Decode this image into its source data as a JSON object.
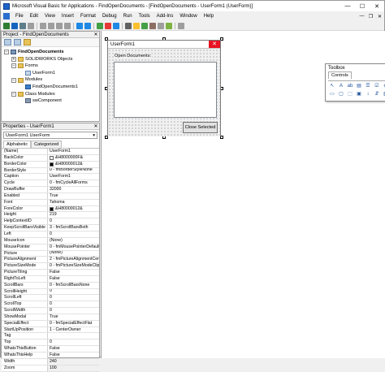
{
  "window": {
    "title": "Microsoft Visual Basic for Applications - FindOpenDocuments - [FindOpenDocuments - UserForm1 (UserForm)]",
    "minimize": "—",
    "maximize": "☐",
    "close": "✕"
  },
  "menu": {
    "items": [
      "File",
      "Edit",
      "View",
      "Insert",
      "Format",
      "Debug",
      "Run",
      "Tools",
      "Add-Ins",
      "Window",
      "Help"
    ],
    "mdi": [
      "—",
      "❐",
      "✕"
    ]
  },
  "project": {
    "title": "Project - FindOpenDocuments",
    "close": "✕",
    "tree": [
      {
        "label": "FindOpenDocuments",
        "indent": 0,
        "icon": "proj",
        "toggle": "−",
        "bold": true
      },
      {
        "label": "SOLIDWORKS Objects",
        "indent": 1,
        "icon": "fold",
        "toggle": "+"
      },
      {
        "label": "Forms",
        "indent": 1,
        "icon": "fold",
        "toggle": "−"
      },
      {
        "label": "UserForm1",
        "indent": 2,
        "icon": "frm",
        "toggle": ""
      },
      {
        "label": "Modules",
        "indent": 1,
        "icon": "fold",
        "toggle": "−"
      },
      {
        "label": "FindOpenDocuments1",
        "indent": 2,
        "icon": "mod",
        "toggle": ""
      },
      {
        "label": "Class Modules",
        "indent": 1,
        "icon": "fold",
        "toggle": "−"
      },
      {
        "label": "swComponent",
        "indent": 2,
        "icon": "cls",
        "toggle": ""
      }
    ]
  },
  "properties": {
    "title": "Properties - UserForm1",
    "close": "✕",
    "object": "UserForm1  UserForm",
    "tabs": [
      "Alphabetic",
      "Categorized"
    ],
    "rows": [
      {
        "k": "(Name)",
        "v": "UserForm1"
      },
      {
        "k": "BackColor",
        "v": "&H8000000F&",
        "sw": "#f0f0f0"
      },
      {
        "k": "BorderColor",
        "v": "&H80000012&",
        "sw": "#000000"
      },
      {
        "k": "BorderStyle",
        "v": "0 - fmBorderStyleNone"
      },
      {
        "k": "Caption",
        "v": "UserForm1"
      },
      {
        "k": "Cycle",
        "v": "0 - fmCycleAllForms"
      },
      {
        "k": "DrawBuffer",
        "v": "32000"
      },
      {
        "k": "Enabled",
        "v": "True"
      },
      {
        "k": "Font",
        "v": "Tahoma"
      },
      {
        "k": "ForeColor",
        "v": "&H80000012&",
        "sw": "#000000"
      },
      {
        "k": "Height",
        "v": "219"
      },
      {
        "k": "HelpContextID",
        "v": "0"
      },
      {
        "k": "KeepScrollBarsVisible",
        "v": "3 - fmScrollBarsBoth"
      },
      {
        "k": "Left",
        "v": "0"
      },
      {
        "k": "MouseIcon",
        "v": "(None)"
      },
      {
        "k": "MousePointer",
        "v": "0 - fmMousePointerDefault"
      },
      {
        "k": "Picture",
        "v": "(None)"
      },
      {
        "k": "PictureAlignment",
        "v": "2 - fmPictureAlignmentCenter"
      },
      {
        "k": "PictureSizeMode",
        "v": "0 - fmPictureSizeModeClip"
      },
      {
        "k": "PictureTiling",
        "v": "False"
      },
      {
        "k": "RightToLeft",
        "v": "False"
      },
      {
        "k": "ScrollBars",
        "v": "0 - fmScrollBarsNone"
      },
      {
        "k": "ScrollHeight",
        "v": "0"
      },
      {
        "k": "ScrollLeft",
        "v": "0"
      },
      {
        "k": "ScrollTop",
        "v": "0"
      },
      {
        "k": "ScrollWidth",
        "v": "0"
      },
      {
        "k": "ShowModal",
        "v": "True"
      },
      {
        "k": "SpecialEffect",
        "v": "0 - fmSpecialEffectFlat"
      },
      {
        "k": "StartUpPosition",
        "v": "1 - CenterOwner"
      },
      {
        "k": "Tag",
        "v": ""
      },
      {
        "k": "Top",
        "v": "0"
      },
      {
        "k": "WhatsThisButton",
        "v": "False"
      },
      {
        "k": "WhatsThisHelp",
        "v": "False"
      },
      {
        "k": "Width",
        "v": "240"
      },
      {
        "k": "Zoom",
        "v": "100"
      }
    ]
  },
  "userform": {
    "title": "UserForm1",
    "close": "✕",
    "label": "Open Documents:",
    "button": "Close Selected"
  },
  "toolbox": {
    "title": "Toolbox",
    "close": "✕",
    "tab": "Controls",
    "tools": [
      {
        "name": "select-objects-icon",
        "glyph": "↖"
      },
      {
        "name": "label-icon",
        "glyph": "A"
      },
      {
        "name": "textbox-icon",
        "glyph": "ab"
      },
      {
        "name": "combobox-icon",
        "glyph": "▤"
      },
      {
        "name": "listbox-icon",
        "glyph": "☰"
      },
      {
        "name": "checkbox-icon",
        "glyph": "☑"
      },
      {
        "name": "optionbutton-icon",
        "glyph": "◉"
      },
      {
        "name": "togglebutton-icon",
        "glyph": "▬"
      },
      {
        "name": "frame-icon",
        "glyph": "▭"
      },
      {
        "name": "commandbutton-icon",
        "glyph": "▢"
      },
      {
        "name": "tabstrip-icon",
        "glyph": "⬚"
      },
      {
        "name": "multipage-icon",
        "glyph": "▣"
      },
      {
        "name": "scrollbar-icon",
        "glyph": "↕"
      },
      {
        "name": "spinbutton-icon",
        "glyph": "⇵"
      },
      {
        "name": "image-icon",
        "glyph": "▧"
      },
      {
        "name": "refedit-icon",
        "glyph": "▦"
      }
    ]
  },
  "toolbar": {
    "icons": [
      "#2e7d32",
      "#1565c0",
      "#607d8b",
      "#9e9e9e",
      "sep",
      "#9e9e9e",
      "#9e9e9e",
      "#9e9e9e",
      "#9e9e9e",
      "sep",
      "#1e88e5",
      "#1e88e5",
      "sep",
      "#43a047",
      "#e53935",
      "#1e88e5",
      "sep",
      "#616161",
      "#fbc02d",
      "#43a047",
      "#8d6e63",
      "#9e9e9e",
      "#7cb342",
      "sep",
      "#9e9e9e"
    ]
  }
}
